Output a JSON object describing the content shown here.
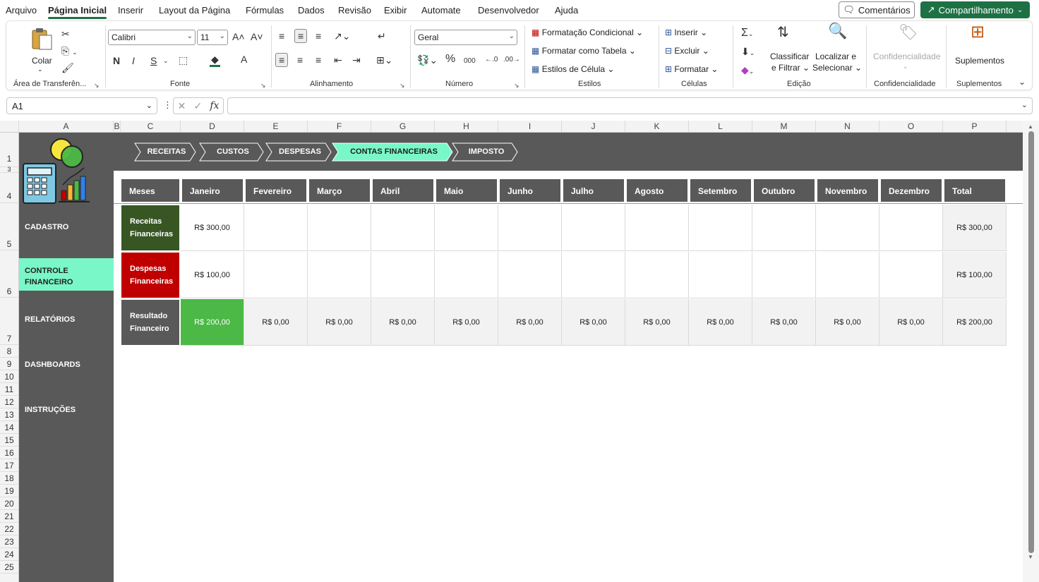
{
  "menu": {
    "items": [
      "Arquivo",
      "Página Inicial",
      "Inserir",
      "Layout da Página",
      "Fórmulas",
      "Dados",
      "Revisão",
      "Exibir",
      "Automate",
      "Desenvolvedor",
      "Ajuda"
    ],
    "comments_label": "Comentários",
    "share_label": "Compartilhamento"
  },
  "ribbon": {
    "clipboard": {
      "paste_label": "Colar",
      "group_label": "Área de Transferên..."
    },
    "font": {
      "font_name": "Calibri",
      "font_size": "11",
      "bold": "N",
      "italic": "I",
      "underline": "S",
      "group_label": "Fonte"
    },
    "alignment": {
      "group_label": "Alinhamento"
    },
    "number": {
      "format": "Geral",
      "group_label": "Número"
    },
    "styles": {
      "conditional": "Formatação Condicional",
      "as_table": "Formatar como Tabela",
      "cell_styles": "Estilos de Célula",
      "group_label": "Estilos"
    },
    "cells": {
      "insert": "Inserir",
      "delete": "Excluir",
      "format": "Formatar",
      "group_label": "Células"
    },
    "editing": {
      "sort_line1": "Classificar",
      "sort_line2": "e Filtrar",
      "find_line1": "Localizar e",
      "find_line2": "Selecionar",
      "group_label": "Edição"
    },
    "sensitivity": {
      "label": "Confidencialidade",
      "group_label": "Confidencialidade"
    },
    "addins": {
      "label": "Suplementos",
      "group_label": "Suplementos"
    }
  },
  "formula_bar": {
    "name_box": "A1",
    "fx": "fx",
    "formula": ""
  },
  "columns": [
    "A",
    "B",
    "C",
    "D",
    "E",
    "F",
    "G",
    "H",
    "I",
    "J",
    "K",
    "L",
    "M",
    "N",
    "O",
    "P"
  ],
  "rows": [
    "1",
    "3",
    "4",
    "5",
    "6",
    "7",
    "8",
    "9",
    "10",
    "11",
    "12",
    "13",
    "14",
    "15",
    "16",
    "17",
    "18",
    "19",
    "20",
    "21",
    "22",
    "23",
    "24",
    "25"
  ],
  "sidebar": [
    "CADASTRO",
    "CONTROLE FINANCEIRO",
    "RELATÓRIOS",
    "DASHBOARDS",
    "INSTRUÇÕES"
  ],
  "tabs": [
    "RECEITAS",
    "CUSTOS",
    "DESPESAS",
    "CONTAS FINANCEIRAS",
    "IMPOSTO"
  ],
  "table": {
    "headers": [
      "Meses",
      "Janeiro",
      "Fevereiro",
      "Março",
      "Abril",
      "Maio",
      "Junho",
      "Julho",
      "Agosto",
      "Setembro",
      "Outubro",
      "Novembro",
      "Dezembro",
      "Total"
    ],
    "rows": [
      {
        "label_line1": "Receitas",
        "label_line2": "Financeiras",
        "color": "#375623",
        "values": [
          "R$ 300,00",
          "",
          "",
          "",
          "",
          "",
          "",
          "",
          "",
          "",
          "",
          "",
          "R$ 300,00"
        ]
      },
      {
        "label_line1": "Despesas",
        "label_line2": "Financeiras",
        "color": "#c00000",
        "values": [
          "R$ 100,00",
          "",
          "",
          "",
          "",
          "",
          "",
          "",
          "",
          "",
          "",
          "",
          "R$ 100,00"
        ]
      },
      {
        "label_line1": "Resultado",
        "label_line2": "Financeiro",
        "color": "#595959",
        "values": [
          "R$ 200,00",
          "R$ 0,00",
          "R$ 0,00",
          "R$ 0,00",
          "R$ 0,00",
          "R$ 0,00",
          "R$ 0,00",
          "R$ 0,00",
          "R$ 0,00",
          "R$ 0,00",
          "R$ 0,00",
          "R$ 0,00",
          "R$ 200,00"
        ]
      }
    ]
  },
  "colors": {
    "accent": "#1e7145",
    "active_tab": "#7af7c8",
    "dark": "#595959",
    "positive": "#4cb846"
  }
}
